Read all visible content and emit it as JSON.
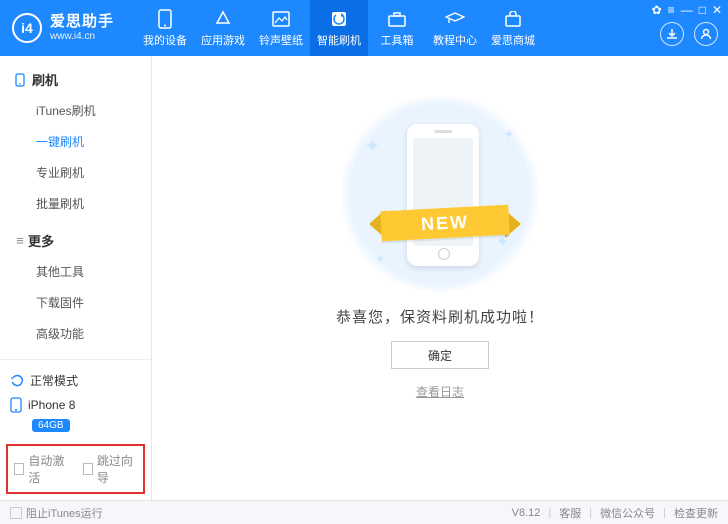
{
  "app": {
    "name": "爱思助手",
    "url": "www.i4.cn",
    "logo_text": "i4"
  },
  "nav": [
    {
      "key": "device",
      "label": "我的设备"
    },
    {
      "key": "apps",
      "label": "应用游戏"
    },
    {
      "key": "ringtone",
      "label": "铃声壁纸"
    },
    {
      "key": "flash",
      "label": "智能刷机",
      "active": true
    },
    {
      "key": "toolbox",
      "label": "工具箱"
    },
    {
      "key": "tutorial",
      "label": "教程中心"
    },
    {
      "key": "mall",
      "label": "爱思商城"
    }
  ],
  "sidebar": {
    "sections": [
      {
        "key": "flash",
        "title": "刷机",
        "icon": "phone",
        "items": [
          {
            "key": "itunes",
            "label": "iTunes刷机"
          },
          {
            "key": "oneclick",
            "label": "一键刷机",
            "active": true
          },
          {
            "key": "pro",
            "label": "专业刷机"
          },
          {
            "key": "batch",
            "label": "批量刷机"
          }
        ]
      },
      {
        "key": "more",
        "title": "更多",
        "icon": "list",
        "items": [
          {
            "key": "other",
            "label": "其他工具"
          },
          {
            "key": "firmware",
            "label": "下载固件"
          },
          {
            "key": "advanced",
            "label": "高级功能"
          }
        ]
      }
    ],
    "mode": {
      "label": "正常模式"
    },
    "device": {
      "name": "iPhone 8",
      "storage": "64GB"
    },
    "options": {
      "auto_activate": "自动激活",
      "skip_guide": "跳过向导"
    }
  },
  "main": {
    "ribbon": "NEW",
    "success": "恭喜您，保资料刷机成功啦！",
    "ok": "确定",
    "view_log": "查看日志"
  },
  "footer": {
    "block_itunes": "阻止iTunes运行",
    "version": "V8.12",
    "support": "客服",
    "wechat": "微信公众号",
    "update": "检查更新"
  }
}
